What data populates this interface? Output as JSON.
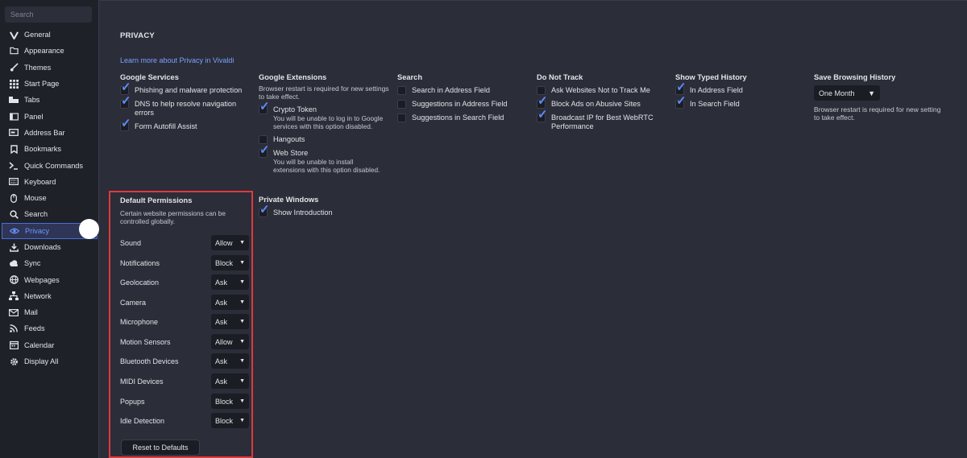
{
  "sidebar": {
    "search_placeholder": "Search",
    "items": [
      {
        "label": "General",
        "icon": "vivaldi-icon"
      },
      {
        "label": "Appearance",
        "icon": "folder-icon"
      },
      {
        "label": "Themes",
        "icon": "brush-icon"
      },
      {
        "label": "Start Page",
        "icon": "grid-icon"
      },
      {
        "label": "Tabs",
        "icon": "tabs-icon"
      },
      {
        "label": "Panel",
        "icon": "panel-icon"
      },
      {
        "label": "Address Bar",
        "icon": "address-bar-icon"
      },
      {
        "label": "Bookmarks",
        "icon": "bookmark-icon"
      },
      {
        "label": "Quick Commands",
        "icon": "quick-commands-icon"
      },
      {
        "label": "Keyboard",
        "icon": "keyboard-icon"
      },
      {
        "label": "Mouse",
        "icon": "mouse-icon"
      },
      {
        "label": "Search",
        "icon": "search-icon"
      },
      {
        "label": "Privacy",
        "icon": "eye-icon"
      },
      {
        "label": "Downloads",
        "icon": "download-icon"
      },
      {
        "label": "Sync",
        "icon": "cloud-icon"
      },
      {
        "label": "Webpages",
        "icon": "globe-icon"
      },
      {
        "label": "Network",
        "icon": "network-icon"
      },
      {
        "label": "Mail",
        "icon": "mail-icon"
      },
      {
        "label": "Feeds",
        "icon": "rss-icon"
      },
      {
        "label": "Calendar",
        "icon": "calendar-icon"
      },
      {
        "label": "Display All",
        "icon": "gear-icon"
      }
    ]
  },
  "privacy": {
    "heading": "PRIVACY",
    "learn_more": "Learn more about Privacy in Vivaldi",
    "google_services": {
      "title": "Google Services",
      "options": [
        {
          "label": "Phishing and malware protection",
          "checked": true
        },
        {
          "label": "DNS to help resolve navigation errors",
          "checked": true
        },
        {
          "label": "Form Autofill Assist",
          "checked": true
        }
      ]
    },
    "google_extensions": {
      "title": "Google Extensions",
      "note": "Browser restart is required for new settings to take effect.",
      "crypto_token": {
        "label": "Crypto Token",
        "checked": true,
        "sub": "You will be unable to log in to Google services with this option disabled."
      },
      "hangouts": {
        "label": "Hangouts",
        "checked": false
      },
      "web_store": {
        "label": "Web Store",
        "checked": true,
        "sub": "You will be unable to install extensions with this option disabled."
      }
    },
    "search": {
      "title": "Search",
      "options": [
        {
          "label": "Search in Address Field",
          "checked": false
        },
        {
          "label": "Suggestions in Address Field",
          "checked": false
        },
        {
          "label": "Suggestions in Search Field",
          "checked": false
        }
      ]
    },
    "do_not_track": {
      "title": "Do Not Track",
      "options": [
        {
          "label": "Ask Websites Not to Track Me",
          "checked": false
        },
        {
          "label": "Block Ads on Abusive Sites",
          "checked": true
        },
        {
          "label": "Broadcast IP for Best WebRTC Performance",
          "checked": true
        }
      ]
    },
    "typed_history": {
      "title": "Show Typed History",
      "options": [
        {
          "label": "In Address Field",
          "checked": true
        },
        {
          "label": "In Search Field",
          "checked": true
        }
      ]
    },
    "browsing_history": {
      "title": "Save Browsing History",
      "selected": "One Month",
      "note": "Browser restart is required for new setting to take effect."
    },
    "private_windows": {
      "title": "Private Windows",
      "option": {
        "label": "Show Introduction",
        "checked": true
      }
    },
    "default_permissions": {
      "title": "Default Permissions",
      "description": "Certain website permissions can be controlled globally.",
      "rows": [
        {
          "label": "Sound",
          "value": "Allow"
        },
        {
          "label": "Notifications",
          "value": "Block"
        },
        {
          "label": "Geolocation",
          "value": "Ask"
        },
        {
          "label": "Camera",
          "value": "Ask"
        },
        {
          "label": "Microphone",
          "value": "Ask"
        },
        {
          "label": "Motion Sensors",
          "value": "Allow"
        },
        {
          "label": "Bluetooth Devices",
          "value": "Ask"
        },
        {
          "label": "MIDI Devices",
          "value": "Ask"
        },
        {
          "label": "Popups",
          "value": "Block"
        },
        {
          "label": "Idle Detection",
          "value": "Block"
        }
      ],
      "reset_label": "Reset to Defaults"
    }
  },
  "colors": {
    "accent": "#5f8cff",
    "highlight_border": "#e0393e",
    "link": "#7aa2ff"
  }
}
